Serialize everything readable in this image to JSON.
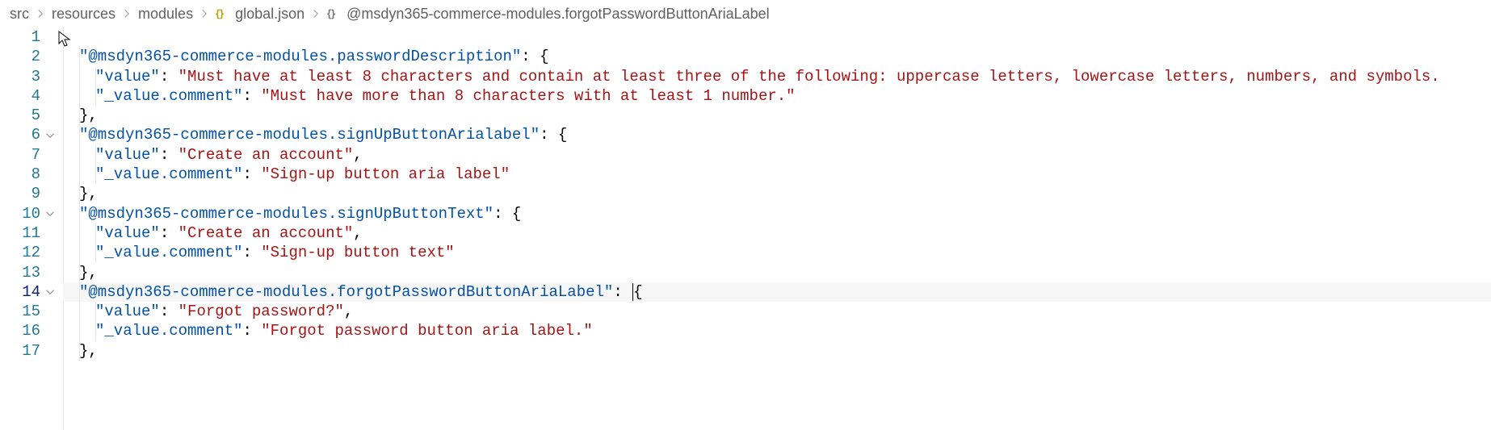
{
  "breadcrumb": {
    "items": [
      "src",
      "resources",
      "modules",
      "global.json",
      "@msdyn365-commerce-modules.forgotPasswordButtonAriaLabel"
    ]
  },
  "code": {
    "lines": [
      {
        "num": "1",
        "fold": false,
        "indent": 0,
        "segs": []
      },
      {
        "num": "2",
        "fold": false,
        "indent": 1,
        "segs": [
          {
            "c": "key",
            "t": "\"@msdyn365-commerce-modules.passwordDescription\""
          },
          {
            "c": "punc",
            "t": ": {"
          }
        ]
      },
      {
        "num": "3",
        "fold": false,
        "indent": 2,
        "segs": [
          {
            "c": "key",
            "t": "\"value\""
          },
          {
            "c": "punc",
            "t": ": "
          },
          {
            "c": "str",
            "t": "\"Must have at least 8 characters and contain at least three of the following: uppercase letters, lowercase letters, numbers, and symbols."
          }
        ]
      },
      {
        "num": "4",
        "fold": false,
        "indent": 2,
        "segs": [
          {
            "c": "key",
            "t": "\"_value.comment\""
          },
          {
            "c": "punc",
            "t": ": "
          },
          {
            "c": "str",
            "t": "\"Must have more than 8 characters with at least 1 number.\""
          }
        ]
      },
      {
        "num": "5",
        "fold": false,
        "indent": 1,
        "segs": [
          {
            "c": "punc",
            "t": "},"
          }
        ]
      },
      {
        "num": "6",
        "fold": true,
        "indent": 1,
        "segs": [
          {
            "c": "key",
            "t": "\"@msdyn365-commerce-modules.signUpButtonArialabel\""
          },
          {
            "c": "punc",
            "t": ": {"
          }
        ]
      },
      {
        "num": "7",
        "fold": false,
        "indent": 2,
        "segs": [
          {
            "c": "key",
            "t": "\"value\""
          },
          {
            "c": "punc",
            "t": ": "
          },
          {
            "c": "str",
            "t": "\"Create an account\""
          },
          {
            "c": "punc",
            "t": ","
          }
        ]
      },
      {
        "num": "8",
        "fold": false,
        "indent": 2,
        "segs": [
          {
            "c": "key",
            "t": "\"_value.comment\""
          },
          {
            "c": "punc",
            "t": ": "
          },
          {
            "c": "str",
            "t": "\"Sign-up button aria label\""
          }
        ]
      },
      {
        "num": "9",
        "fold": false,
        "indent": 1,
        "segs": [
          {
            "c": "punc",
            "t": "},"
          }
        ]
      },
      {
        "num": "10",
        "fold": true,
        "indent": 1,
        "segs": [
          {
            "c": "key",
            "t": "\"@msdyn365-commerce-modules.signUpButtonText\""
          },
          {
            "c": "punc",
            "t": ": {"
          }
        ]
      },
      {
        "num": "11",
        "fold": false,
        "indent": 2,
        "segs": [
          {
            "c": "key",
            "t": "\"value\""
          },
          {
            "c": "punc",
            "t": ": "
          },
          {
            "c": "str",
            "t": "\"Create an account\""
          },
          {
            "c": "punc",
            "t": ","
          }
        ]
      },
      {
        "num": "12",
        "fold": false,
        "indent": 2,
        "segs": [
          {
            "c": "key",
            "t": "\"_value.comment\""
          },
          {
            "c": "punc",
            "t": ": "
          },
          {
            "c": "str",
            "t": "\"Sign-up button text\""
          }
        ]
      },
      {
        "num": "13",
        "fold": false,
        "indent": 1,
        "segs": [
          {
            "c": "punc",
            "t": "},"
          }
        ]
      },
      {
        "num": "14",
        "fold": true,
        "indent": 1,
        "active": true,
        "highlight": true,
        "segs": [
          {
            "c": "key",
            "t": "\"@msdyn365-commerce-modules.forgotPasswordButtonAriaLabel\""
          },
          {
            "c": "punc",
            "t": ": "
          },
          {
            "c": "punc",
            "t": "{",
            "cursor": true
          }
        ]
      },
      {
        "num": "15",
        "fold": false,
        "indent": 2,
        "segs": [
          {
            "c": "key",
            "t": "\"value\""
          },
          {
            "c": "punc",
            "t": ": "
          },
          {
            "c": "str",
            "t": "\"Forgot password?\""
          },
          {
            "c": "punc",
            "t": ","
          }
        ]
      },
      {
        "num": "16",
        "fold": false,
        "indent": 2,
        "segs": [
          {
            "c": "key",
            "t": "\"_value.comment\""
          },
          {
            "c": "punc",
            "t": ": "
          },
          {
            "c": "str",
            "t": "\"Forgot password button aria label.\""
          }
        ]
      },
      {
        "num": "17",
        "fold": false,
        "indent": 1,
        "segs": [
          {
            "c": "punc",
            "t": "},"
          }
        ]
      }
    ]
  }
}
